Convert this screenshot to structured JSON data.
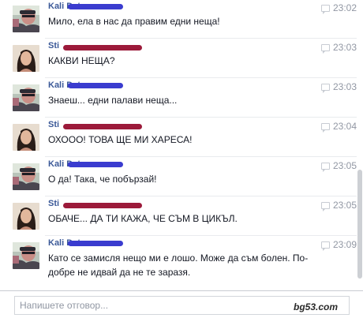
{
  "chat": {
    "reply_placeholder": "Напишете отговор...",
    "watermark": "bg53.com",
    "colors": {
      "sender_a_redaction": "#3a3ccf",
      "sender_b_redaction": "#9c1a3a",
      "link": "#3b5998"
    },
    "messages": [
      {
        "sender": "Kali Dat",
        "sender_id": "a",
        "avatar": "man-avatar-icon",
        "time": "23:02",
        "lines": [
          "Мило, ела в нас да правим едни неща!"
        ]
      },
      {
        "sender": "Sti",
        "sender_id": "b",
        "avatar": "woman-avatar-icon",
        "time": "23:03",
        "lines": [
          "КАКВИ НЕЩА?"
        ]
      },
      {
        "sender": "Kali Dat",
        "sender_id": "a",
        "avatar": "man-avatar-icon",
        "time": "23:03",
        "lines": [
          "Знаеш... едни палави неща..."
        ]
      },
      {
        "sender": "Sti",
        "sender_id": "b",
        "avatar": "woman-avatar-icon",
        "time": "23:04",
        "lines": [
          "ОХООО! ТОВА ЩЕ МИ ХАРЕСА!"
        ]
      },
      {
        "sender": "Kali Dat",
        "sender_id": "a",
        "avatar": "man-avatar-icon",
        "time": "23:05",
        "lines": [
          "О да! Така, че побързай!"
        ]
      },
      {
        "sender": "Sti",
        "sender_id": "b",
        "avatar": "woman-avatar-icon",
        "time": "23:05",
        "lines": [
          "ОБАЧЕ... ДА ТИ КАЖА, ЧЕ СЪМ В ЦИКЪЛ."
        ]
      },
      {
        "sender": "Kali Dat",
        "sender_id": "a",
        "avatar": "man-avatar-icon",
        "time": "23:09",
        "lines": [
          "Като се замисля нещо ми е лошо. Може да съм болен. По-",
          "добре не идвай да не те заразя."
        ]
      }
    ]
  }
}
